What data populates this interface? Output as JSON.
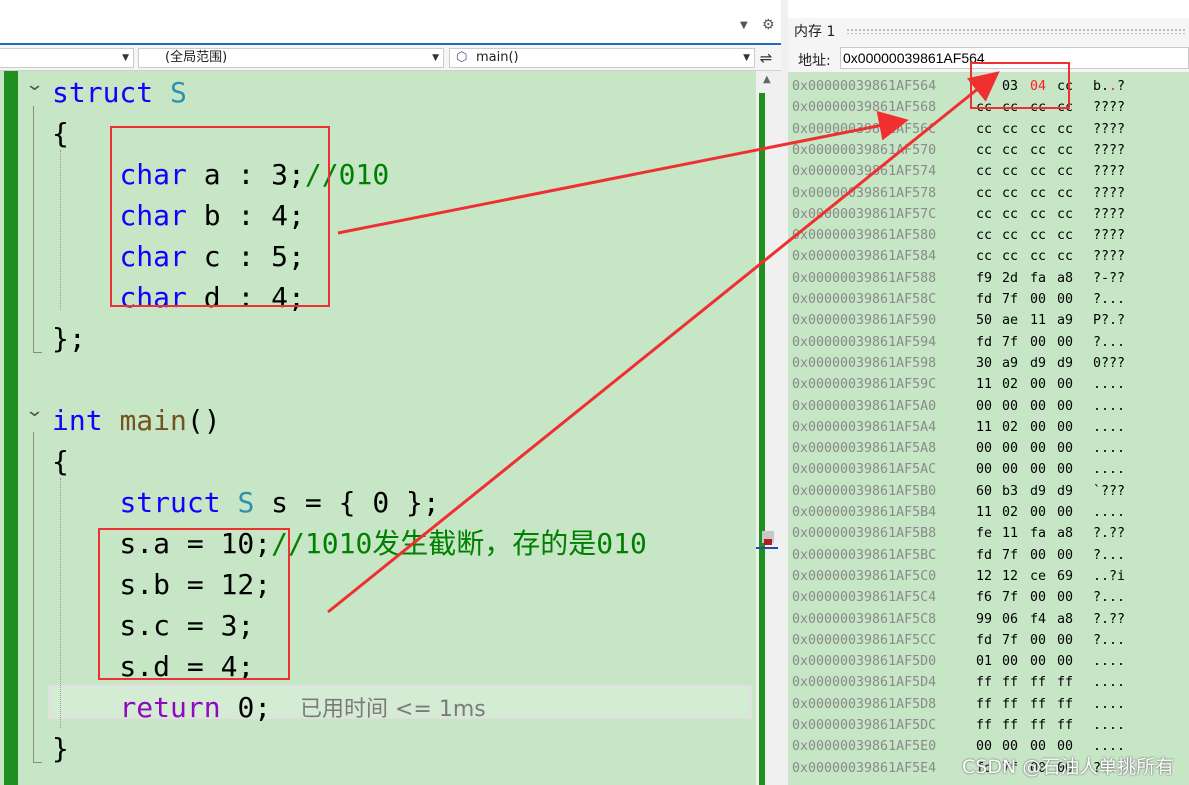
{
  "editor": {
    "scope_dropdown": "(全局范围)",
    "function_dropdown": "main()",
    "code_lines": [
      [
        {
          "t": "kw",
          "v": "struct"
        },
        {
          "t": "pl",
          "v": " "
        },
        {
          "t": "ty",
          "v": "S"
        }
      ],
      [
        {
          "t": "pl",
          "v": "{"
        }
      ],
      [
        {
          "t": "pl",
          "v": "    "
        },
        {
          "t": "kw",
          "v": "char"
        },
        {
          "t": "pl",
          "v": " a : 3;"
        },
        {
          "t": "cm",
          "v": "//010"
        }
      ],
      [
        {
          "t": "pl",
          "v": "    "
        },
        {
          "t": "kw",
          "v": "char"
        },
        {
          "t": "pl",
          "v": " b : 4;"
        }
      ],
      [
        {
          "t": "pl",
          "v": "    "
        },
        {
          "t": "kw",
          "v": "char"
        },
        {
          "t": "pl",
          "v": " c : 5;"
        }
      ],
      [
        {
          "t": "pl",
          "v": "    "
        },
        {
          "t": "kw",
          "v": "char"
        },
        {
          "t": "pl",
          "v": " d : 4;"
        }
      ],
      [
        {
          "t": "pl",
          "v": "};"
        }
      ],
      [],
      [
        {
          "t": "kw",
          "v": "int"
        },
        {
          "t": "pl",
          "v": " "
        },
        {
          "t": "fn",
          "v": "main"
        },
        {
          "t": "pl",
          "v": "()"
        }
      ],
      [
        {
          "t": "pl",
          "v": "{"
        }
      ],
      [
        {
          "t": "pl",
          "v": "    "
        },
        {
          "t": "kw",
          "v": "struct"
        },
        {
          "t": "pl",
          "v": " "
        },
        {
          "t": "ty",
          "v": "S"
        },
        {
          "t": "pl",
          "v": " s = { 0 };"
        }
      ],
      [
        {
          "t": "pl",
          "v": "    s.a = 10;"
        },
        {
          "t": "cm",
          "v": "//1010发生截断，存的是010"
        }
      ],
      [
        {
          "t": "pl",
          "v": "    s.b = 12;"
        }
      ],
      [
        {
          "t": "pl",
          "v": "    s.c = 3;"
        }
      ],
      [
        {
          "t": "pl",
          "v": "    s.d = 4;"
        }
      ],
      [
        {
          "t": "pl",
          "v": "    "
        },
        {
          "t": "rk",
          "v": "return"
        },
        {
          "t": "pl",
          "v": " 0;"
        }
      ],
      [
        {
          "t": "pl",
          "v": "}"
        }
      ]
    ],
    "perf_hint": "已用时间 <= 1ms"
  },
  "memory": {
    "title": "内存 1",
    "address_label": "地址:",
    "address_value": "0x00000039861AF564",
    "rows": [
      {
        "addr": "0x00000039861AF564",
        "bytes": [
          "62",
          "03",
          "04",
          "cc"
        ],
        "ascii": "b.",
        "ascii_red": ".",
        "ascii_tail": "?",
        "hl": 2
      },
      {
        "addr": "0x00000039861AF568",
        "bytes": [
          "cc",
          "cc",
          "cc",
          "cc"
        ],
        "ascii": "????"
      },
      {
        "addr": "0x00000039861AF56C",
        "bytes": [
          "cc",
          "cc",
          "cc",
          "cc"
        ],
        "ascii": "????"
      },
      {
        "addr": "0x00000039861AF570",
        "bytes": [
          "cc",
          "cc",
          "cc",
          "cc"
        ],
        "ascii": "????"
      },
      {
        "addr": "0x00000039861AF574",
        "bytes": [
          "cc",
          "cc",
          "cc",
          "cc"
        ],
        "ascii": "????"
      },
      {
        "addr": "0x00000039861AF578",
        "bytes": [
          "cc",
          "cc",
          "cc",
          "cc"
        ],
        "ascii": "????"
      },
      {
        "addr": "0x00000039861AF57C",
        "bytes": [
          "cc",
          "cc",
          "cc",
          "cc"
        ],
        "ascii": "????"
      },
      {
        "addr": "0x00000039861AF580",
        "bytes": [
          "cc",
          "cc",
          "cc",
          "cc"
        ],
        "ascii": "????"
      },
      {
        "addr": "0x00000039861AF584",
        "bytes": [
          "cc",
          "cc",
          "cc",
          "cc"
        ],
        "ascii": "????"
      },
      {
        "addr": "0x00000039861AF588",
        "bytes": [
          "f9",
          "2d",
          "fa",
          "a8"
        ],
        "ascii": "?-??"
      },
      {
        "addr": "0x00000039861AF58C",
        "bytes": [
          "fd",
          "7f",
          "00",
          "00"
        ],
        "ascii": "?..."
      },
      {
        "addr": "0x00000039861AF590",
        "bytes": [
          "50",
          "ae",
          "11",
          "a9"
        ],
        "ascii": "P?.?"
      },
      {
        "addr": "0x00000039861AF594",
        "bytes": [
          "fd",
          "7f",
          "00",
          "00"
        ],
        "ascii": "?..."
      },
      {
        "addr": "0x00000039861AF598",
        "bytes": [
          "30",
          "a9",
          "d9",
          "d9"
        ],
        "ascii": "0???"
      },
      {
        "addr": "0x00000039861AF59C",
        "bytes": [
          "11",
          "02",
          "00",
          "00"
        ],
        "ascii": "...."
      },
      {
        "addr": "0x00000039861AF5A0",
        "bytes": [
          "00",
          "00",
          "00",
          "00"
        ],
        "ascii": "...."
      },
      {
        "addr": "0x00000039861AF5A4",
        "bytes": [
          "11",
          "02",
          "00",
          "00"
        ],
        "ascii": "...."
      },
      {
        "addr": "0x00000039861AF5A8",
        "bytes": [
          "00",
          "00",
          "00",
          "00"
        ],
        "ascii": "...."
      },
      {
        "addr": "0x00000039861AF5AC",
        "bytes": [
          "00",
          "00",
          "00",
          "00"
        ],
        "ascii": "...."
      },
      {
        "addr": "0x00000039861AF5B0",
        "bytes": [
          "60",
          "b3",
          "d9",
          "d9"
        ],
        "ascii": "`???"
      },
      {
        "addr": "0x00000039861AF5B4",
        "bytes": [
          "11",
          "02",
          "00",
          "00"
        ],
        "ascii": "...."
      },
      {
        "addr": "0x00000039861AF5B8",
        "bytes": [
          "fe",
          "11",
          "fa",
          "a8"
        ],
        "ascii": "?.??"
      },
      {
        "addr": "0x00000039861AF5BC",
        "bytes": [
          "fd",
          "7f",
          "00",
          "00"
        ],
        "ascii": "?..."
      },
      {
        "addr": "0x00000039861AF5C0",
        "bytes": [
          "12",
          "12",
          "ce",
          "69"
        ],
        "ascii": "..?i"
      },
      {
        "addr": "0x00000039861AF5C4",
        "bytes": [
          "f6",
          "7f",
          "00",
          "00"
        ],
        "ascii": "?..."
      },
      {
        "addr": "0x00000039861AF5C8",
        "bytes": [
          "99",
          "06",
          "f4",
          "a8"
        ],
        "ascii": "?.??"
      },
      {
        "addr": "0x00000039861AF5CC",
        "bytes": [
          "fd",
          "7f",
          "00",
          "00"
        ],
        "ascii": "?..."
      },
      {
        "addr": "0x00000039861AF5D0",
        "bytes": [
          "01",
          "00",
          "00",
          "00"
        ],
        "ascii": "...."
      },
      {
        "addr": "0x00000039861AF5D4",
        "bytes": [
          "ff",
          "ff",
          "ff",
          "ff"
        ],
        "ascii": "...."
      },
      {
        "addr": "0x00000039861AF5D8",
        "bytes": [
          "ff",
          "ff",
          "ff",
          "ff"
        ],
        "ascii": "...."
      },
      {
        "addr": "0x00000039861AF5DC",
        "bytes": [
          "ff",
          "ff",
          "ff",
          "ff"
        ],
        "ascii": "...."
      },
      {
        "addr": "0x00000039861AF5E0",
        "bytes": [
          "00",
          "00",
          "00",
          "00"
        ],
        "ascii": "...."
      },
      {
        "addr": "0x00000039861AF5E4",
        "bytes": [
          "fd",
          "7f",
          "00",
          "00"
        ],
        "ascii": "?..."
      }
    ]
  },
  "watermark": "CSDN @石油人单挑所有",
  "colors": {
    "annotation_red": "#f03030",
    "editor_bg": "#c6e6c6",
    "change_bar": "#1f8f1f"
  }
}
